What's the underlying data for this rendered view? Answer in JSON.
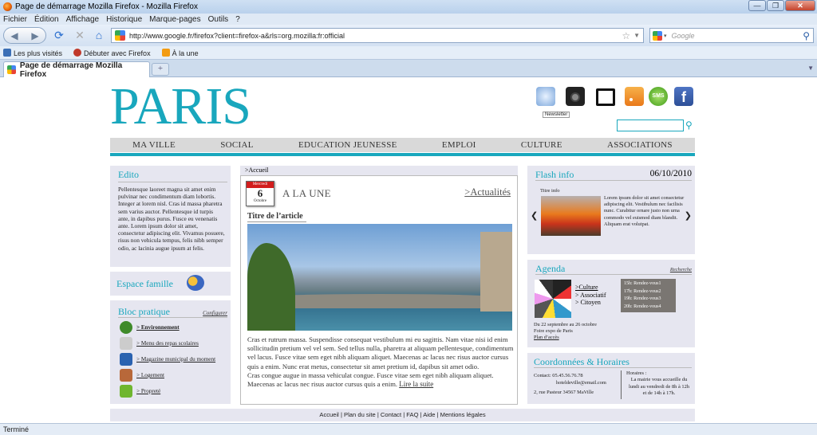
{
  "window": {
    "title": "Page de démarrage Mozilla Firefox - Mozilla Firefox",
    "min": "—",
    "max": "❐",
    "close": "✕"
  },
  "menu": [
    "Fichier",
    "Édition",
    "Affichage",
    "Historique",
    "Marque-pages",
    "Outils",
    "?"
  ],
  "nav": {
    "url": "http://www.google.fr/firefox?client=firefox-a&rls=org.mozilla:fr:official",
    "search_placeholder": "Google"
  },
  "bookmarks": [
    "Les plus visités",
    "Débuter avec Firefox",
    "À la une"
  ],
  "tab": {
    "label": "Page de démarrage Mozilla Firefox",
    "new": "+"
  },
  "status": "Terminé",
  "site": {
    "logo": "PARIS",
    "tooltip": "Newsletter",
    "menu": [
      "MA VILLE",
      "SOCIAL",
      "EDUCATION JEUNESSE",
      "EMPLOI",
      "CULTURE",
      "ASSOCIATIONS"
    ],
    "edito": {
      "title": "Edito",
      "text": "Pellentesque laoreet magna sit amet enim pulvinar nec condimentum diam lobortis. Integer at lorem nisl. Cras id massa pharetra sem varius auctor. Pellentesque id turpis ante, in dapibus purus. Fusce eu venenatis ante. Lorem ipsum dolor sit amet, consectetur adipiscing elit. Vivamus posuere, risus non vehicula tempus, felis nibh semper odio, ac lacinia augue ipsum at felis."
    },
    "espace_famille": "Espace famille",
    "bloc": {
      "title": "Bloc pratique",
      "config": "Configurer",
      "items": [
        "> Environnement",
        "> Menu des repas scolaires",
        "> Magazine municipal du moment",
        "> Logement",
        "> Propreté"
      ]
    },
    "breadcrumb": ">Accueil",
    "une": {
      "date_top": "Mercredi",
      "date_day": "6",
      "date_month": "Octobre",
      "title": "A LA UNE",
      "link": ">Actualités",
      "article_title": "Titre de l’article",
      "text": "Cras et rutrum massa. Suspendisse consequat vestibulum mi eu sagittis. Nam vitae nisi id enim sollicitudin pretium vel vel sem. Sed tellus nulla, pharetra at aliquam pellentesque, condimentum vel lacus. Fusce vitae sem eget nibh aliquam aliquet. Maecenas ac lacus nec risus auctor cursus quis a enim. Nunc erat metus, consectetur sit amet pretium id, dapibus sit amet odio.",
      "text2": "Cras congue augue in massa vehiculat congue. Fusce vitae sem eget nibh aliquam aliquet. Maecenas ac lacus nec risus auctor cursus quis a enim.",
      "read_more": "Lire la suite"
    },
    "flash": {
      "title": "Flash info",
      "date": "06/10/2010",
      "sub": "Titre info",
      "text": "Lorem ipsum dolor sit amet consectetur adipiscing elit. Vestibulum nec facilisis nunc. Curabitur ornare justo non urna commodo vel euismod diam blandit. Aliquam erat volutpat.",
      "prev": "❮",
      "next": "❯"
    },
    "agenda": {
      "title": "Agenda",
      "search": "Recherche",
      "cats": [
        ">Culture",
        "> Associatif",
        "> Citoyen"
      ],
      "rdv": [
        "15h: Rendez-vous1",
        "17h: Rendez-vous2",
        "19h: Rendez-vous3",
        "20h: Rendez-vous4"
      ],
      "event_date": "Du 22 septembre au 26 octobre",
      "event_name": "Foire expo de Paris",
      "event_link": "Plan d’accès"
    },
    "coord": {
      "title": "Coordonnées & Horaires",
      "contact": "Contact: 05.45.56.76.78",
      "email": "hoteldeville@email.com",
      "address": "2, rue Pasteur 34567 MaVille",
      "hours_title": "Horaires :",
      "hours": "La mairie vous accueille du lundi au vendredi de 8h à 12h et de 14h à 17h."
    },
    "footer": "Accueil | Plan du site | Contact | FAQ | Aide | Mentions légales"
  }
}
